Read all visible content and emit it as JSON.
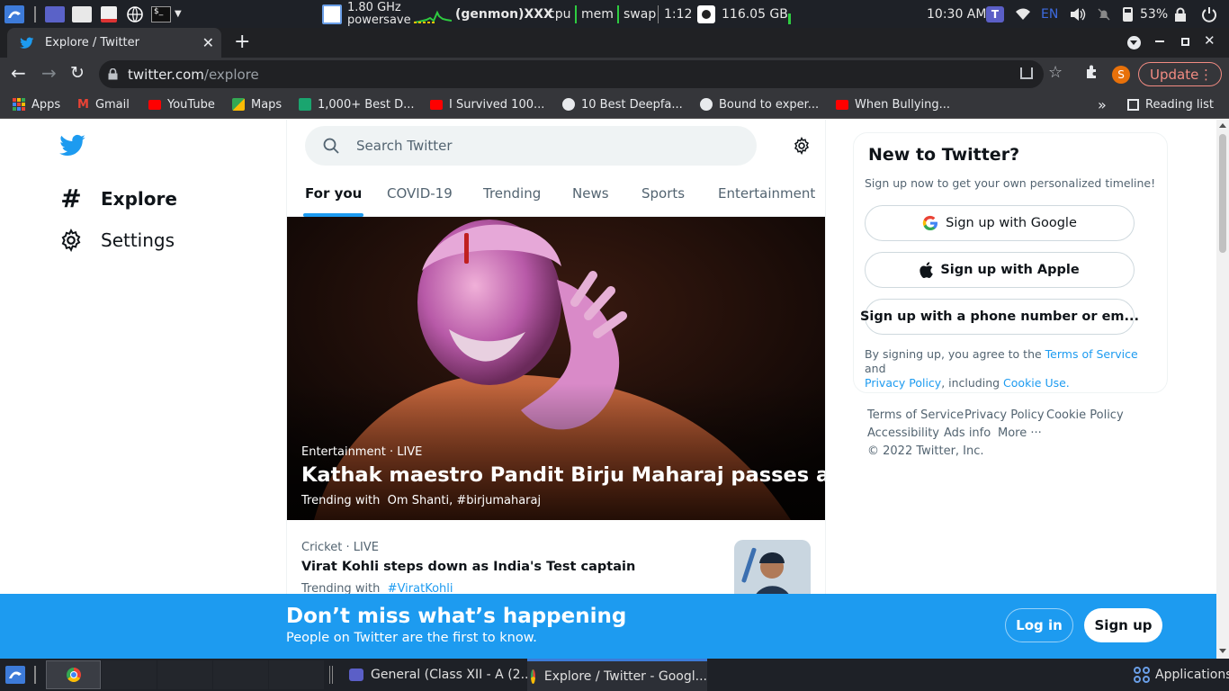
{
  "os_top": {
    "cpu_freq": "1.80 GHz",
    "cpu_gov": "powersave",
    "genmon": "(genmon)XXX",
    "cpu_label": "cpu",
    "mem_label": "mem",
    "swap_label": "swap",
    "uptime": "1:12",
    "disk": "116.05 GB",
    "clock": "10:30 AM",
    "lang": "EN",
    "battery": "53%"
  },
  "browser": {
    "tab_title": "Explore / Twitter",
    "url_host": "twitter.com",
    "url_path": "/explore",
    "profile_initial": "S",
    "update_label": "Update",
    "reading_list": "Reading list",
    "bookmarks": [
      "Apps",
      "Gmail",
      "YouTube",
      "Maps",
      "1,000+ Best D...",
      "I Survived 100...",
      "10 Best Deepfa...",
      "Bound to exper...",
      "When Bullying..."
    ]
  },
  "sidebar": {
    "items": [
      {
        "label": "Explore",
        "icon": "hashtag-icon"
      },
      {
        "label": "Settings",
        "icon": "gear-icon"
      }
    ]
  },
  "explore": {
    "search_placeholder": "Search Twitter",
    "tabs": [
      "For you",
      "COVID-19",
      "Trending",
      "News",
      "Sports",
      "Entertainment"
    ],
    "active_tab": "For you",
    "hero": {
      "meta": "Entertainment · LIVE",
      "title": "Kathak maestro Pandit Birju Maharaj passes away",
      "trending_with_label": "Trending with",
      "trending_with": "Om Shanti, #birjumaharaj"
    },
    "story": {
      "meta": "Cricket · LIVE",
      "title": "Virat Kohli steps down as India's Test captain",
      "trending_with_label": "Trending with",
      "hashtag": "#ViratKohli"
    }
  },
  "signup_card": {
    "title": "New to Twitter?",
    "subtitle": "Sign up now to get your own personalized timeline!",
    "google": "Sign up with Google",
    "apple": "Sign up with Apple",
    "phone": "Sign up with a phone number or em...",
    "legal_prefix": "By signing up, you agree to the",
    "tos": "Terms of Service",
    "and": "and",
    "privacy": "Privacy Policy",
    "including": ", including",
    "cookie": "Cookie Use."
  },
  "footer_links": {
    "tos": "Terms of Service",
    "privacy": "Privacy Policy",
    "cookie": "Cookie Policy",
    "accessibility": "Accessibility",
    "ads": "Ads info",
    "more": "More ···",
    "copyright": "© 2022 Twitter, Inc."
  },
  "banner": {
    "title": "Don’t miss what’s happening",
    "subtitle": "People on Twitter are the first to know.",
    "login": "Log in",
    "signup": "Sign up"
  },
  "taskbar": {
    "window1": "General (Class XII - A (2...",
    "window2": "Explore / Twitter - Googl...",
    "applications": "Applications"
  },
  "colors": {
    "twitter_blue": "#1d9bf0",
    "os_panel": "#1e2127",
    "chrome_dark": "#35363a"
  }
}
